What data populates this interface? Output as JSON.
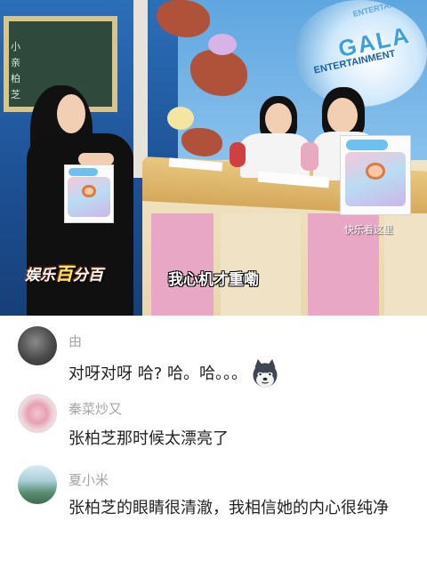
{
  "video": {
    "subtitle": "我心机才重嘞",
    "watermark_prefix": "娱乐",
    "watermark_hundred": "百",
    "watermark_suffix": "分百",
    "corner_tag": "快乐看这里",
    "studio_logo_top": "ENTERTAINM",
    "studio_logo_big": "GALA",
    "studio_logo_small": "ENTERTAINMENT",
    "chalkboard_text": [
      "小",
      "亲",
      "柏",
      "芝"
    ]
  },
  "comments": [
    {
      "username": "由",
      "text": "对呀对呀 哈? 哈。哈。。。",
      "emoji": "husky-dog-emoji"
    },
    {
      "username": "秦菜炒又",
      "text": "张柏芝那时候太漂亮了"
    },
    {
      "username": "夏小米",
      "text": "张柏芝的眼睛很清澈，我相信她的内心很纯净"
    }
  ]
}
